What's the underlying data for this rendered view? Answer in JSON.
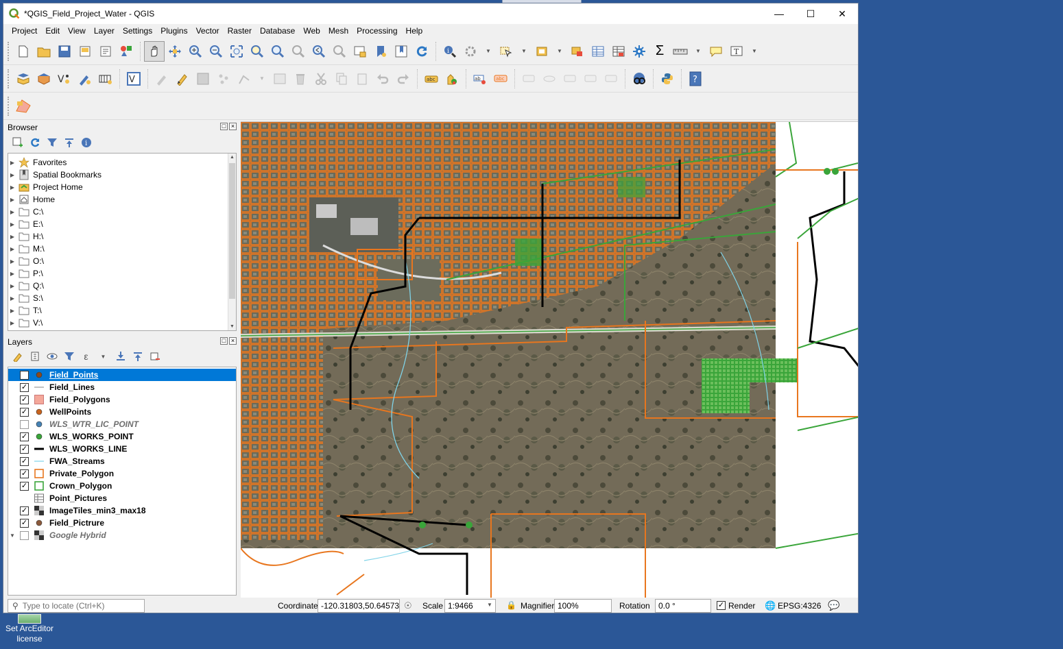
{
  "window": {
    "title": "*QGIS_Field_Project_Water - QGIS",
    "controls": [
      "minimize-icon",
      "maximize-icon",
      "close-icon"
    ]
  },
  "menu": [
    "Project",
    "Edit",
    "View",
    "Layer",
    "Settings",
    "Plugins",
    "Vector",
    "Raster",
    "Database",
    "Web",
    "Mesh",
    "Processing",
    "Help"
  ],
  "browser": {
    "title": "Browser",
    "items": [
      {
        "label": "Favorites",
        "icon": "star-icon"
      },
      {
        "label": "Spatial Bookmarks",
        "icon": "bookmark-icon"
      },
      {
        "label": "Project Home",
        "icon": "project-home-icon"
      },
      {
        "label": "Home",
        "icon": "home-icon"
      },
      {
        "label": "C:\\",
        "icon": "folder-icon"
      },
      {
        "label": "E:\\",
        "icon": "folder-icon"
      },
      {
        "label": "H:\\",
        "icon": "folder-icon"
      },
      {
        "label": "M:\\",
        "icon": "folder-icon"
      },
      {
        "label": "O:\\",
        "icon": "folder-icon"
      },
      {
        "label": "P:\\",
        "icon": "folder-icon"
      },
      {
        "label": "Q:\\",
        "icon": "folder-icon"
      },
      {
        "label": "S:\\",
        "icon": "folder-icon"
      },
      {
        "label": "T:\\",
        "icon": "folder-icon"
      },
      {
        "label": "V:\\",
        "icon": "folder-icon"
      }
    ]
  },
  "layers": {
    "title": "Layers",
    "items": [
      {
        "name": "Field_Points",
        "checked": true,
        "style": "bold",
        "selected": true,
        "symbol": "point",
        "color": "#8b4a1f"
      },
      {
        "name": "Field_Lines",
        "checked": true,
        "style": "bold",
        "symbol": "line",
        "color": "#9a9a9a"
      },
      {
        "name": "Field_Polygons",
        "checked": true,
        "style": "bold",
        "symbol": "fill",
        "color": "#f4a89a"
      },
      {
        "name": "WellPoints",
        "checked": true,
        "style": "bold",
        "symbol": "point",
        "color": "#c8641e"
      },
      {
        "name": "WLS_WTR_LIC_POINT",
        "checked": false,
        "style": "italic",
        "symbol": "point",
        "color": "#4682b4"
      },
      {
        "name": "WLS_WORKS_POINT",
        "checked": true,
        "style": "bold",
        "symbol": "point",
        "color": "#3aa53a"
      },
      {
        "name": "WLS_WORKS_LINE",
        "checked": true,
        "style": "bold",
        "symbol": "thickline",
        "color": "#000000"
      },
      {
        "name": "FWA_Streams",
        "checked": true,
        "style": "bold",
        "symbol": "line",
        "color": "#7fd3e8"
      },
      {
        "name": "Private_Polygon",
        "checked": true,
        "style": "bold",
        "symbol": "outline",
        "color": "#e8761e"
      },
      {
        "name": "Crown_Polygon",
        "checked": true,
        "style": "bold",
        "symbol": "outline",
        "color": "#3aa53a"
      },
      {
        "name": "Point_Pictures",
        "checked": null,
        "style": "bold",
        "symbol": "table",
        "color": "#888888"
      },
      {
        "name": "ImageTiles_min3_max18",
        "checked": true,
        "style": "bold",
        "symbol": "raster",
        "color": "#444444"
      },
      {
        "name": "Field_Pictrure",
        "checked": true,
        "style": "bold",
        "symbol": "point",
        "color": "#8b5a3c"
      },
      {
        "name": "Google Hybrid",
        "checked": false,
        "style": "italic",
        "symbol": "raster",
        "color": "#444444"
      }
    ]
  },
  "status": {
    "locate_placeholder": "Type to locate (Ctrl+K)",
    "coordinate_label": "Coordinate",
    "coordinate_value": "-120.31803,50.64573",
    "scale_label": "Scale",
    "scale_value": "1:9466",
    "magnifier_label": "Magnifier",
    "magnifier_value": "100%",
    "rotation_label": "Rotation",
    "rotation_value": "0.0 °",
    "render_label": "Render",
    "crs_label": "EPSG:4326"
  },
  "desktop": {
    "icon_label": "Set ArcEditor license"
  },
  "colors": {
    "accent": "#0078d7",
    "private_polygon": "#e8761e",
    "crown_polygon": "#3aa53a",
    "works_line": "#000000",
    "streams": "#7fd3e8"
  }
}
